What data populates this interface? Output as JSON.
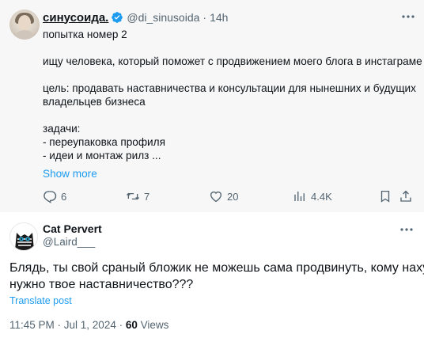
{
  "colors": {
    "accent": "#1d9bf0",
    "muted": "#536471",
    "text": "#0f1419",
    "verified": "#1d9bf0",
    "parent_bg": "#f7f7f7"
  },
  "parent_post": {
    "display_name": "синусоида.",
    "handle": "@di_sinusoida",
    "separator": "·",
    "time": "14h",
    "verified_icon": "verified-badge-icon",
    "more_icon": "more-dots-icon",
    "lines": [
      "попытка номер 2",
      "",
      "ищу человека, который поможет с продвижением моего блога в инстаграме",
      "",
      "цель: продавать наставничества и консультации для нынешних и будущих",
      "владельцев бизнеса",
      "",
      "задачи:",
      "- переупаковка профиля",
      "- идеи и монтаж рилз ..."
    ],
    "show_more": "Show more",
    "actions": {
      "replies": "6",
      "reposts": "7",
      "likes": "20",
      "views": "4.4K"
    }
  },
  "reply_post": {
    "display_name": "Cat Pervert",
    "handle": "@Laird___",
    "more_icon": "more-dots-icon",
    "lines": [
      "Блядь, ты свой сраный бложик не можешь сама продвинуть, кому нахуй",
      "нужно твое наставничество???"
    ],
    "translate": "Translate post",
    "timestamp": "11:45 PM · Jul 1, 2024 · ",
    "views_count": "60",
    "views_label": " Views"
  }
}
